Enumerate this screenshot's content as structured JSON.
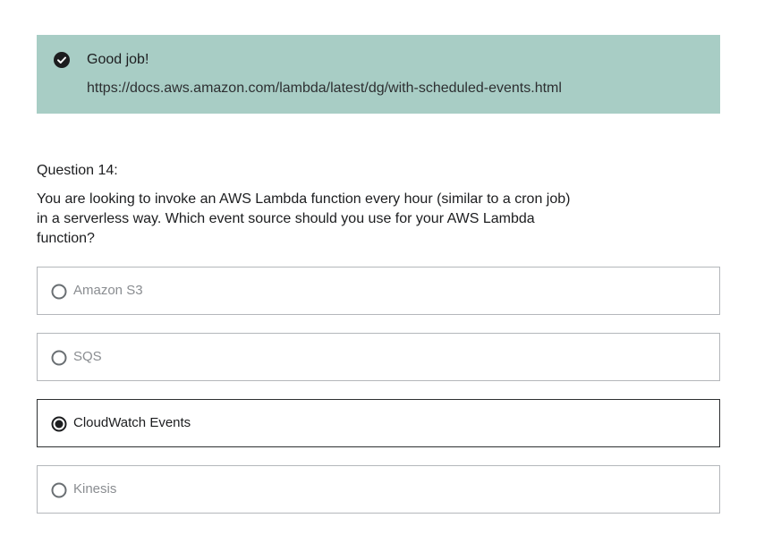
{
  "feedback": {
    "title": "Good job!",
    "link": "https://docs.aws.amazon.com/lambda/latest/dg/with-scheduled-events.html",
    "icon": "check-circle-icon",
    "background": "#a8cdc5"
  },
  "question": {
    "label": "Question 14:",
    "text": "You are looking to invoke an AWS Lambda function every hour (similar to a cron job) in a serverless way. Which event source should you use for your AWS Lambda function?"
  },
  "options": [
    {
      "label": "Amazon S3",
      "selected": false
    },
    {
      "label": "SQS",
      "selected": false
    },
    {
      "label": "CloudWatch Events",
      "selected": true
    },
    {
      "label": "Kinesis",
      "selected": false
    }
  ]
}
